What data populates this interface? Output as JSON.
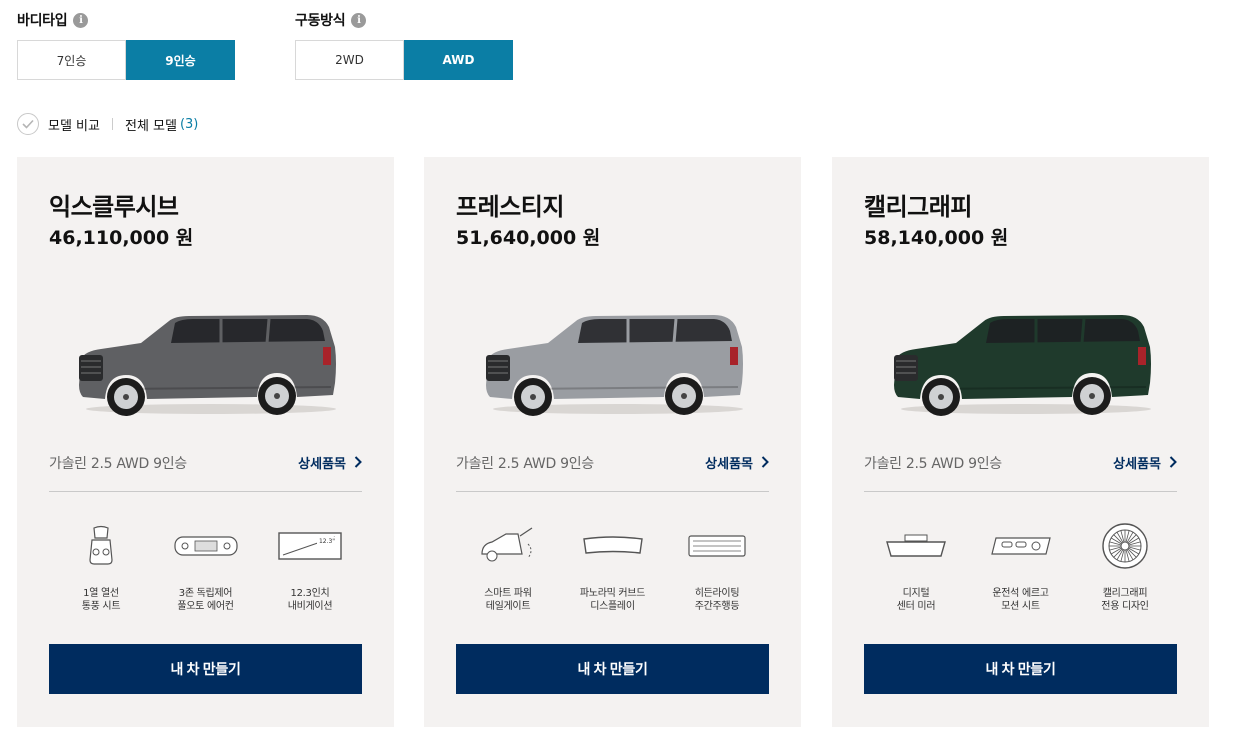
{
  "filters": {
    "body_type": {
      "title": "바디타입",
      "options": [
        "7인승",
        "9인승"
      ],
      "selected": "9인승"
    },
    "drive": {
      "title": "구동방식",
      "options": [
        "2WD",
        "AWD"
      ],
      "selected": "AWD"
    }
  },
  "info_glyph": "i",
  "compare": {
    "label": "모델 비교",
    "all_label": "전체 모델",
    "count": "(3)"
  },
  "detail_label": "상세품목",
  "build_label": "내 차 만들기",
  "cards": [
    {
      "name": "익스클루시브",
      "price": "46,110,000 원",
      "spec": "가솔린 2.5 AWD 9인승",
      "car_color": "#5f6063",
      "features": [
        {
          "icon": "ventilated-seat-icon",
          "label": "1열 열선\n통풍 시트"
        },
        {
          "icon": "climate-control-icon",
          "label": "3존 독립제어\n풀오토 에어컨"
        },
        {
          "icon": "navigation-display-icon",
          "label": "12.3인치\n내비게이션",
          "badge": "12.3\""
        }
      ]
    },
    {
      "name": "프레스티지",
      "price": "51,640,000 원",
      "spec": "가솔린 2.5 AWD 9인승",
      "car_color": "#9a9da2",
      "features": [
        {
          "icon": "smart-tailgate-icon",
          "label": "스마트 파워\n테일게이트"
        },
        {
          "icon": "panoramic-display-icon",
          "label": "파노라믹 커브드\n디스플레이"
        },
        {
          "icon": "hidden-drl-icon",
          "label": "히든라이팅\n주간주행등"
        }
      ]
    },
    {
      "name": "캘리그래피",
      "price": "58,140,000 원",
      "spec": "가솔린 2.5 AWD 9인승",
      "car_color": "#1f3a2c",
      "features": [
        {
          "icon": "digital-mirror-icon",
          "label": "디지털\n센터 미러"
        },
        {
          "icon": "ergo-seat-control-icon",
          "label": "운전석 에르고\n모션 시트"
        },
        {
          "icon": "calligraphy-wheel-icon",
          "label": "캘리그래피\n전용 디자인"
        }
      ]
    }
  ]
}
